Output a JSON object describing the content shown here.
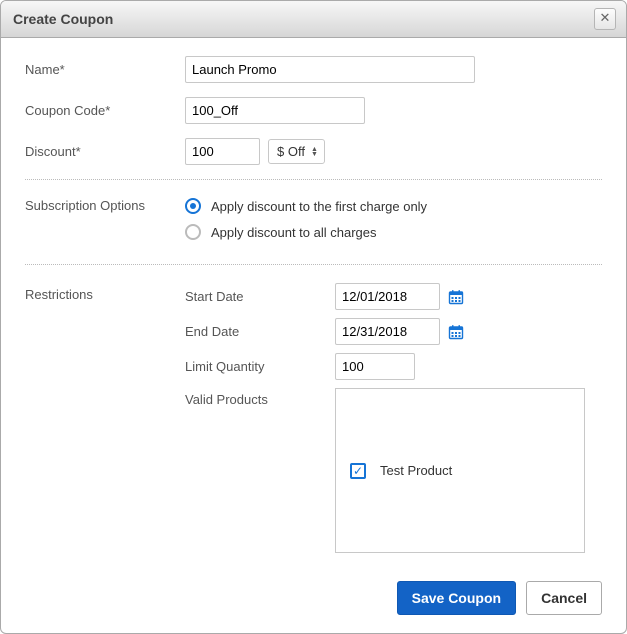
{
  "dialog": {
    "title": "Create Coupon"
  },
  "labels": {
    "name": "Name*",
    "code": "Coupon Code*",
    "discount": "Discount*",
    "sub_options": "Subscription Options",
    "restrictions": "Restrictions",
    "start_date": "Start Date",
    "end_date": "End Date",
    "limit_qty": "Limit Quantity",
    "valid_products": "Valid Products"
  },
  "values": {
    "name": "Launch Promo",
    "code": "100_Off",
    "discount": "100",
    "discount_type": "$ Off",
    "start_date": "12/01/2018",
    "end_date": "12/31/2018",
    "limit_qty": "100"
  },
  "radios": {
    "first_only": "Apply discount to the first charge only",
    "all_charges": "Apply discount to all charges"
  },
  "products": {
    "item1": "Test Product"
  },
  "buttons": {
    "save": "Save Coupon",
    "cancel": "Cancel"
  }
}
